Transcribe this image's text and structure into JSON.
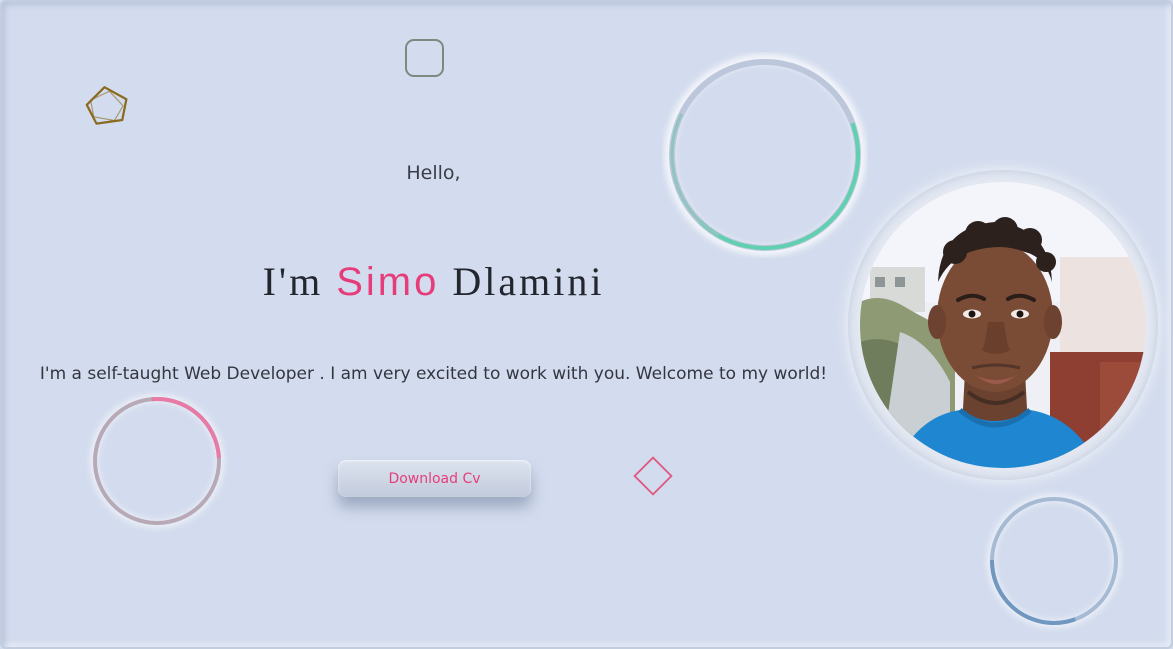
{
  "hero": {
    "greeting": "Hello,",
    "name_prefix": "I'm ",
    "name_first": "Simo",
    "name_last": " Dlamini",
    "tagline": "I'm a self-taught Web Developer . I am very excited to work with you. Welcome to my world!",
    "cta_label": "Download Cv"
  },
  "colors": {
    "background": "#d3dcee",
    "accent": "#e63d7a",
    "ring_teal": "#5fd0b0",
    "ring_pink": "#e87aa6",
    "ring_blue": "#7aa3c8",
    "pentagon": "#8a6a1f"
  },
  "icons": {
    "pentagon": "pentagon-outline-icon",
    "square": "rounded-square-outline-icon",
    "diamond": "diamond-outline-icon"
  }
}
